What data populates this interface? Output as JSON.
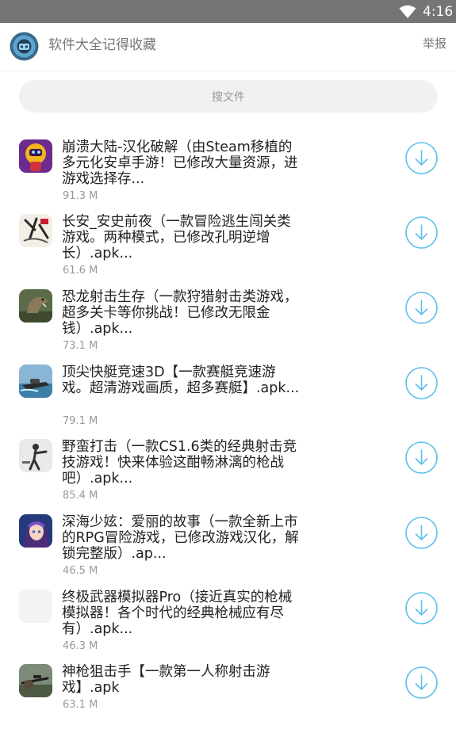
{
  "status_bar": {
    "time": "4:16",
    "background": "#757575"
  },
  "header": {
    "title": "软件大全记得收藏",
    "report_label": "举报",
    "logo_icon": "app-logo-icon"
  },
  "search": {
    "placeholder": "搜文件"
  },
  "colors": {
    "accent": "#5bc0eb",
    "size_text": "#999999"
  },
  "items": [
    {
      "title": "崩溃大陆-汉化破解（由Steam移植的多元化安卓手游！已修改大量资源，进游戏选择存...",
      "size": "91.3 M",
      "icon": "game-icon-crashlands"
    },
    {
      "title": "长安_安史前夜（一款冒险逃生闯关类游戏。两种模式，已修改孔明逆增长）.apk...",
      "size": "61.6 M",
      "icon": "game-icon-changan"
    },
    {
      "title": "恐龙射击生存（一款狩猎射击类游戏，超多关卡等你挑战！已修改无限金钱）.apk...",
      "size": "73.1 M",
      "icon": "game-icon-dinosaur"
    },
    {
      "title": "顶尖快艇竞速3D【一款赛艇竞速游戏。超清游戏画质，超多赛艇】.apk...",
      "size": "79.1 M",
      "icon": "game-icon-boat"
    },
    {
      "title": "野蛮打击（一款CS1.6类的经典射击竞技游戏！快来体验这酣畅淋漓的枪战吧）.apk...",
      "size": "85.4 M",
      "icon": "game-icon-strike"
    },
    {
      "title": "深海少妶：爱丽的故事（一款全新上市的RPG冒险游戏，已修改游戏汉化，解锁完整版）.ap...",
      "size": "46.5 M",
      "icon": "game-icon-anime-girl"
    },
    {
      "title": "终极武器模拟器Pro（接近真实的枪械模拟器！各个时代的经典枪械应有尽有）.apk...",
      "size": "46.3 M",
      "icon": "game-icon-placeholder"
    },
    {
      "title": "神枪狙击手【一款第一人称射击游戏】.apk",
      "size": "63.1 M",
      "icon": "game-icon-sniper"
    }
  ]
}
